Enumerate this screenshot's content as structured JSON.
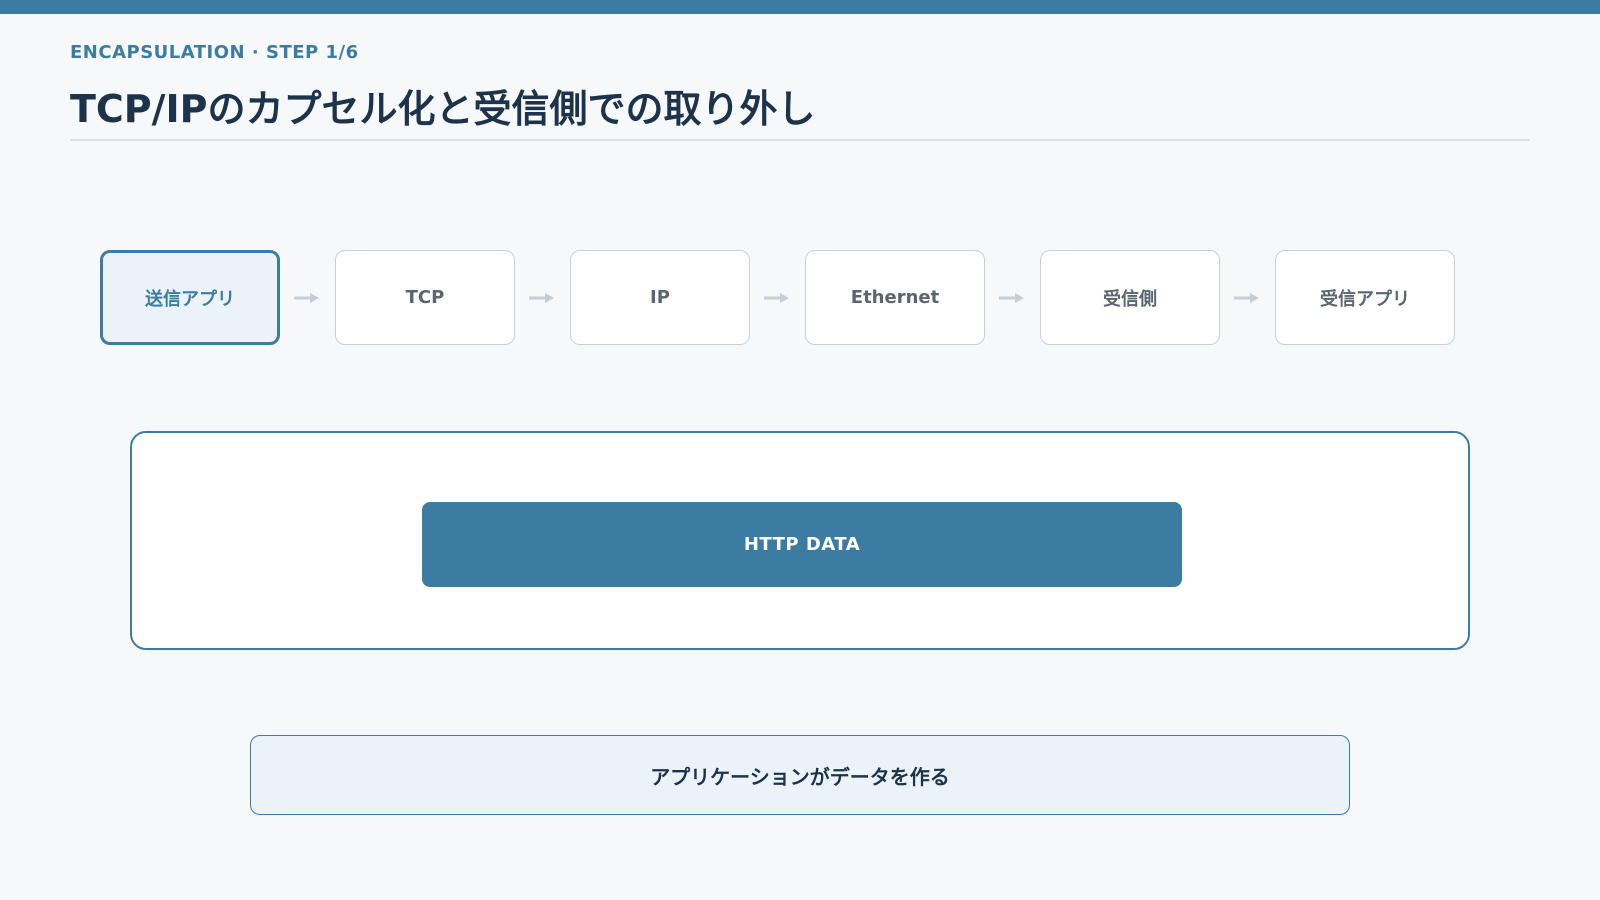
{
  "header": {
    "eyebrow": "ENCAPSULATION · STEP 1/6",
    "title": "TCP/IPのカプセル化と受信側での取り外し"
  },
  "steps": [
    {
      "label": "送信アプリ",
      "active": true
    },
    {
      "label": "TCP",
      "active": false
    },
    {
      "label": "IP",
      "active": false
    },
    {
      "label": "Ethernet",
      "active": false
    },
    {
      "label": "受信側",
      "active": false
    },
    {
      "label": "受信アプリ",
      "active": false
    }
  ],
  "stage": {
    "payload_label": "HTTP DATA"
  },
  "caption": "アプリケーションがデータを作る",
  "colors": {
    "accent": "#3d7ca2",
    "title": "#1c3349",
    "active_fill": "#ebf3f9",
    "arrow": "#c5ced6"
  }
}
